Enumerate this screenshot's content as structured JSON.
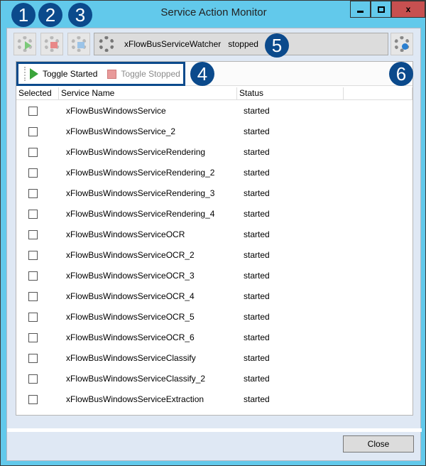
{
  "window": {
    "title": "Service Action Monitor",
    "minimize": "▁",
    "maximize": "▢",
    "close": "x"
  },
  "toolbar": {
    "watcher_name": "xFlowBusServiceWatcher",
    "watcher_status": "stopped"
  },
  "toolstrip": {
    "toggle_started": "Toggle Started",
    "toggle_stopped": "Toggle Stopped"
  },
  "columns": [
    "Selected",
    "Service Name",
    "Status",
    ""
  ],
  "rows": [
    {
      "name": "xFlowBusWindowsService",
      "status": "started"
    },
    {
      "name": "xFlowBusWindowsService_2",
      "status": "started"
    },
    {
      "name": "xFlowBusWindowsServiceRendering",
      "status": "started"
    },
    {
      "name": "xFlowBusWindowsServiceRendering_2",
      "status": "started"
    },
    {
      "name": "xFlowBusWindowsServiceRendering_3",
      "status": "started"
    },
    {
      "name": "xFlowBusWindowsServiceRendering_4",
      "status": "started"
    },
    {
      "name": "xFlowBusWindowsServiceOCR",
      "status": "started"
    },
    {
      "name": "xFlowBusWindowsServiceOCR_2",
      "status": "started"
    },
    {
      "name": "xFlowBusWindowsServiceOCR_3",
      "status": "started"
    },
    {
      "name": "xFlowBusWindowsServiceOCR_4",
      "status": "started"
    },
    {
      "name": "xFlowBusWindowsServiceOCR_5",
      "status": "started"
    },
    {
      "name": "xFlowBusWindowsServiceOCR_6",
      "status": "started"
    },
    {
      "name": "xFlowBusWindowsServiceClassify",
      "status": "started"
    },
    {
      "name": "xFlowBusWindowsServiceClassify_2",
      "status": "started"
    },
    {
      "name": "xFlowBusWindowsServiceExtraction",
      "status": "started"
    }
  ],
  "footer": {
    "close_label": "Close"
  },
  "badges": [
    "1",
    "2",
    "3",
    "4",
    "5",
    "6"
  ],
  "colors": {
    "frame": "#62c9eb",
    "badge": "#0b4a8c",
    "close_button": "#c75050",
    "client": "#dfe8f4"
  }
}
